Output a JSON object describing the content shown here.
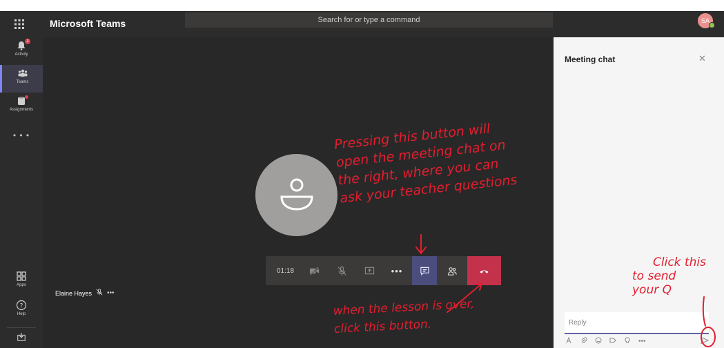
{
  "app": {
    "title": "Microsoft Teams",
    "avatar_initials": "SA"
  },
  "search": {
    "placeholder": "Search for or type a command"
  },
  "rail": {
    "items": [
      {
        "label": "Activity",
        "icon": "bell-icon",
        "badge": "1"
      },
      {
        "label": "Teams",
        "icon": "teams-icon",
        "active": true
      },
      {
        "label": "Assignments",
        "icon": "assignments-icon",
        "dot": true
      },
      {
        "label": "Apps",
        "icon": "apps-icon"
      },
      {
        "label": "Help",
        "icon": "help-icon"
      }
    ],
    "more": "• • •"
  },
  "call": {
    "timer": "01:18",
    "participant_name": "Elaine Hayes",
    "controls": [
      "camera-off-icon",
      "mic-off-icon",
      "share-screen-icon",
      "more-icon",
      "chat-icon",
      "participants-icon",
      "hang-up-icon"
    ]
  },
  "chat": {
    "title": "Meeting chat",
    "reply_placeholder": "Reply",
    "toolbar_icons": [
      "format-icon",
      "attach-icon",
      "emoji-icon",
      "gif-icon",
      "sticker-icon",
      "more-icon",
      "send-icon"
    ]
  },
  "annotations": {
    "chat_note_1": "Pressing this button will",
    "chat_note_2": "open the meeting chat on",
    "chat_note_3": "the right, where you can",
    "chat_note_4": "ask your teacher questions",
    "end_note_1": "when the lesson is over,",
    "end_note_2": "click this button.",
    "send_note_1": "Click this",
    "send_note_2": "to send",
    "send_note_3": "your Q"
  },
  "colors": {
    "annotation": "#e21f2f",
    "accent": "#6264a7",
    "hangup": "#c4314b",
    "rail": "#2d2c2c",
    "stage": "#292828"
  }
}
